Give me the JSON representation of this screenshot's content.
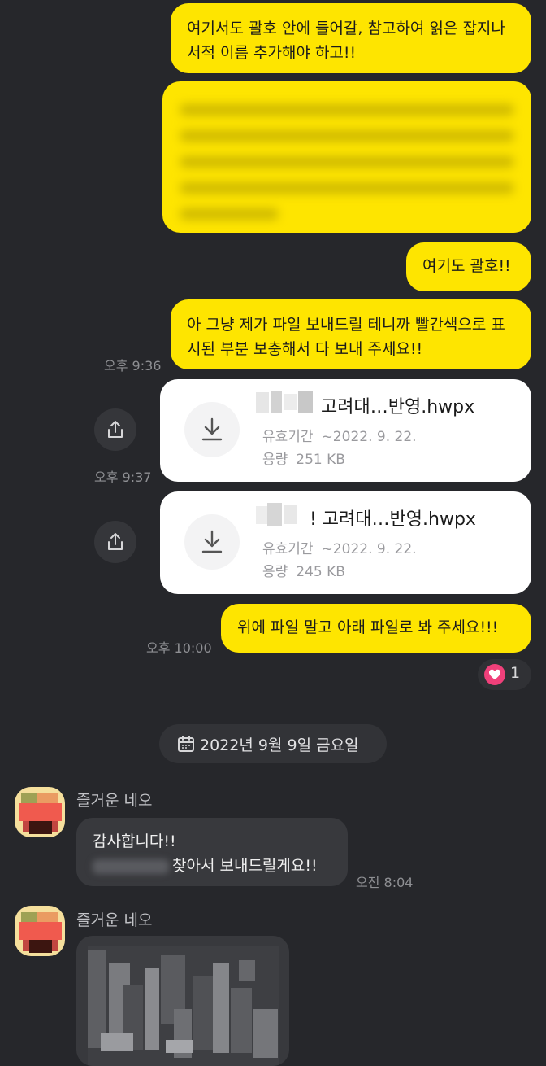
{
  "messages_out": {
    "msg1": "여기서도 괄호 안에 들어갈, 참고하여 읽은 잡지나 서적 이름 추가해야 하고!!",
    "msg3": "여기도 괄호!!",
    "msg4": "아 그냥 제가 파일 보내드릴 테니까 빨간색으로 표시된 부분 보충해서 다 보내 주세요!!",
    "time4": "오후 9:36",
    "msg5": "위에 파일 말고 아래 파일로 봐 주세요!!!",
    "time5": "오후 10:00",
    "reaction_count": "1"
  },
  "files": [
    {
      "name": "고려대…반영.hwpx",
      "expiry_label": "유효기간",
      "expiry_value": "~2022. 9. 22.",
      "size_label": "용량",
      "size_value": "251 KB",
      "time": "오후 9:37"
    },
    {
      "name": "! 고려대…반영.hwpx",
      "expiry_label": "유효기간",
      "expiry_value": "~2022. 9. 22.",
      "size_label": "용량",
      "size_value": "245 KB",
      "time": ""
    }
  ],
  "date_divider": "2022년 9월 9일 금요일",
  "incoming": {
    "sender": "즐거운 네오",
    "line1": "감사합니다!!",
    "line2": "찾아서 보내드릴게요!!",
    "time": "오전 8:04",
    "sender2": "즐거운 네오"
  },
  "colors": {
    "background": "#26272b",
    "my_bubble": "#fee500",
    "other_bubble": "#38393d",
    "heart": "#f0407a"
  },
  "icons": {
    "download": "download-icon",
    "share": "share-icon",
    "calendar": "calendar-icon",
    "heart": "heart-icon"
  }
}
